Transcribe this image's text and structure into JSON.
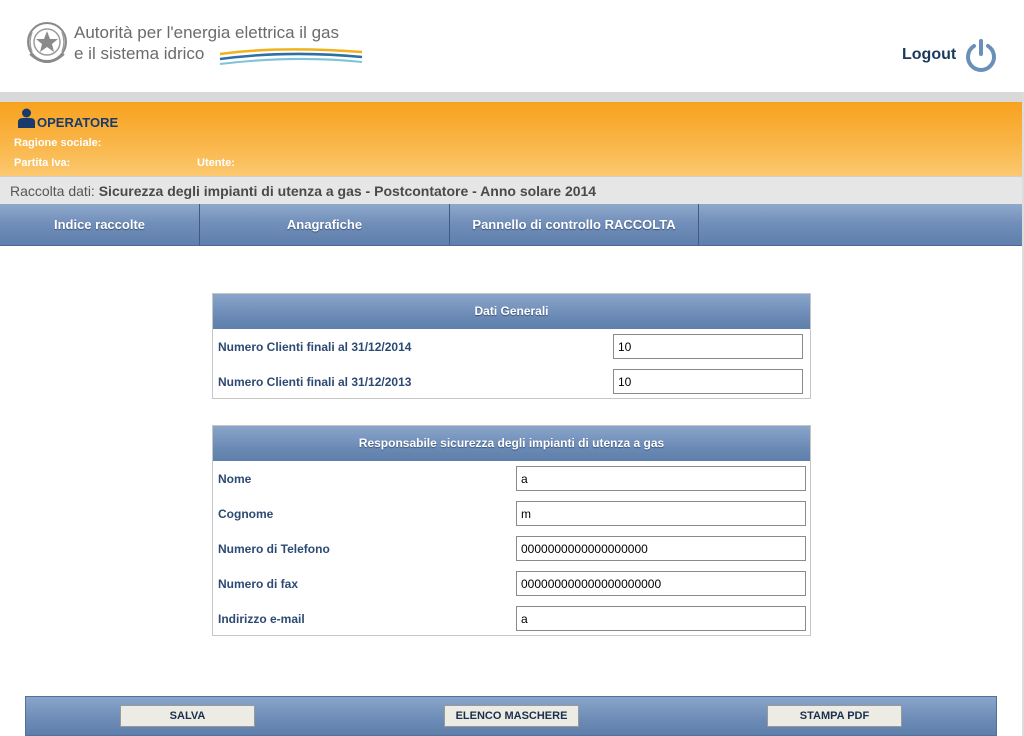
{
  "header": {
    "logo_line1": "Autorità per l'energia elettrica il gas",
    "logo_line2": "e il sistema idrico",
    "logout_label": "Logout"
  },
  "operator": {
    "title": "OPERATORE",
    "ragione_sociale_label": "Ragione sociale:",
    "partita_iva_label": "Partita Iva:",
    "utente_label": "Utente:"
  },
  "raccolta": {
    "prefix": "Raccolta dati:",
    "title": "Sicurezza degli impianti di utenza a gas - Postcontatore - Anno solare 2014"
  },
  "nav": {
    "items": [
      {
        "label": "Indice raccolte"
      },
      {
        "label": "Anagrafiche"
      },
      {
        "label": "Pannello di controllo RACCOLTA"
      }
    ]
  },
  "dati_generali": {
    "title": "Dati Generali",
    "rows": [
      {
        "label": "Numero Clienti finali al 31/12/2014",
        "value": "10"
      },
      {
        "label": "Numero Clienti finali al 31/12/2013",
        "value": "10"
      }
    ]
  },
  "responsabile": {
    "title": "Responsabile sicurezza degli impianti di utenza a gas",
    "rows": [
      {
        "label": "Nome",
        "value": "a"
      },
      {
        "label": "Cognome",
        "value": "m"
      },
      {
        "label": "Numero di Telefono",
        "value": "0000000000000000000"
      },
      {
        "label": "Numero di fax",
        "value": "000000000000000000000"
      },
      {
        "label": "Indirizzo e-mail",
        "value": "a"
      }
    ]
  },
  "footer": {
    "salva_label": "SALVA",
    "elenco_label": "ELENCO MASCHERE",
    "stampa_label": "STAMPA PDF"
  },
  "colors": {
    "orange_band": "#f9b547",
    "nav_blue": "#6f8db8",
    "label_blue": "#2c4a73"
  },
  "icons": {
    "emblem": "republic-emblem-icon",
    "power": "power-icon",
    "operator": "user-icon"
  }
}
